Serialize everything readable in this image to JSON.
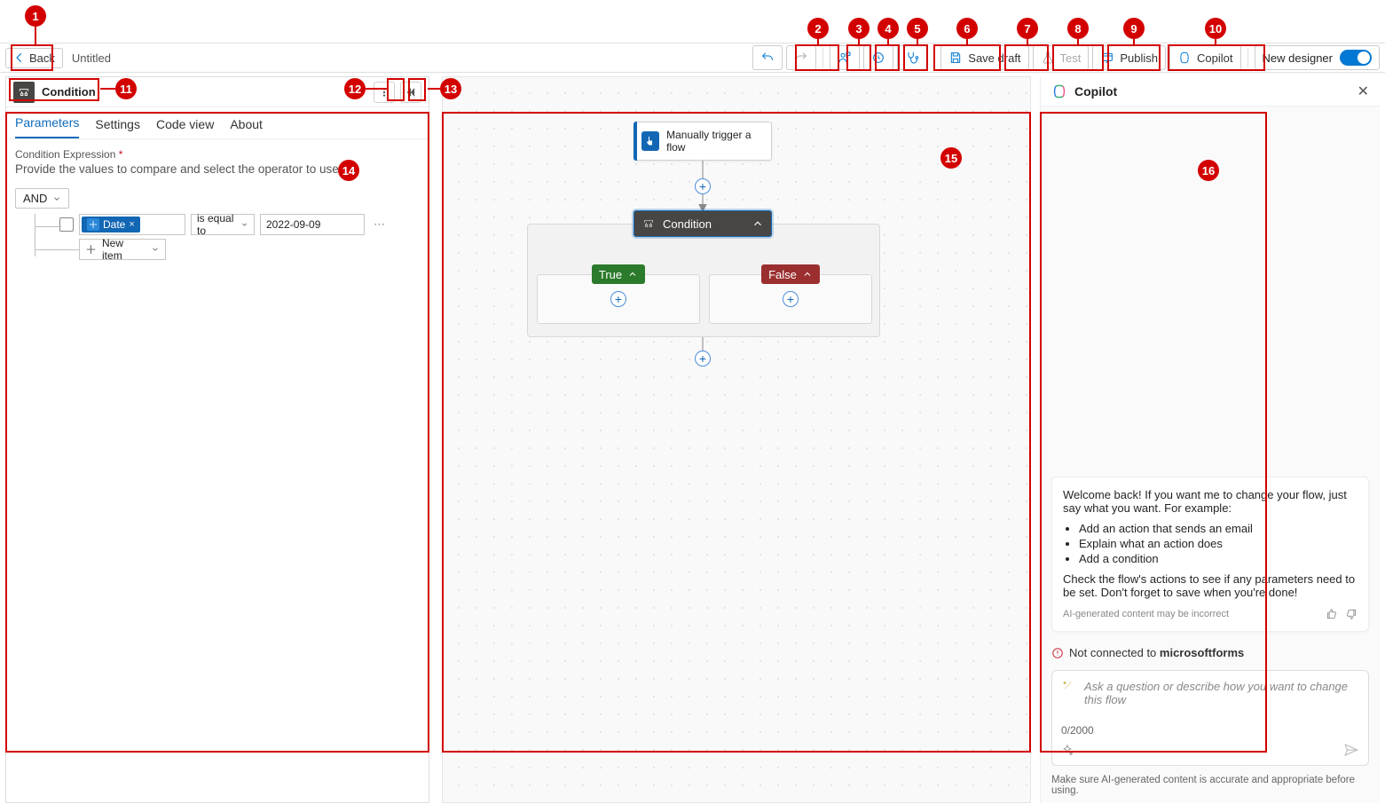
{
  "header": {
    "back_label": "Back",
    "title": "Untitled",
    "save_draft": "Save draft",
    "test": "Test",
    "publish": "Publish",
    "copilot": "Copilot",
    "new_designer": "New designer"
  },
  "panel": {
    "title": "Condition",
    "tabs": {
      "parameters": "Parameters",
      "settings": "Settings",
      "code_view": "Code view",
      "about": "About"
    },
    "expr_label": "Condition Expression",
    "expr_hint": "Provide the values to compare and select the operator to use.",
    "and_label": "AND",
    "token_label": "Date",
    "operator": "is equal to",
    "value": "2022-09-09",
    "new_item": "New item"
  },
  "canvas": {
    "trigger_label": "Manually trigger a flow",
    "condition_label": "Condition",
    "true_label": "True",
    "false_label": "False"
  },
  "copilot": {
    "title": "Copilot",
    "welcome_a": "Welcome back! If you want me to change your flow, just say what you want. For example:",
    "bullets": [
      "Add an action that sends an email",
      "Explain what an action does",
      "Add a condition"
    ],
    "welcome_b": "Check the flow's actions to see if any parameters need to be set. Don't forget to save when you're done!",
    "ai_note": "AI-generated content may be incorrect",
    "not_connected_pre": "Not connected to ",
    "not_connected_b": "microsoftforms",
    "placeholder": "Ask a question or describe how you want to change this flow",
    "count": "0/2000",
    "disclaimer": "Make sure AI-generated content is accurate and appropriate before using."
  }
}
